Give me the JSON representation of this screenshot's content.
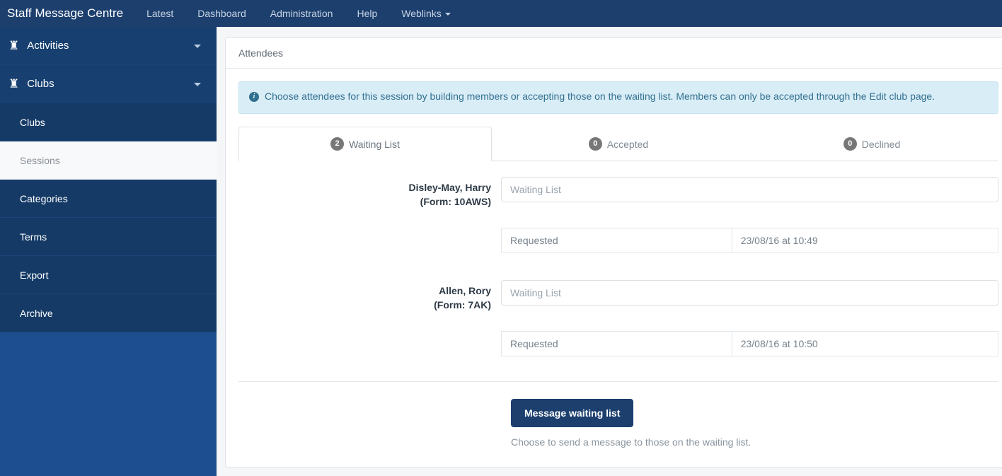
{
  "navbar": {
    "brand": "Staff Message Centre",
    "links": [
      {
        "label": "Latest"
      },
      {
        "label": "Dashboard"
      },
      {
        "label": "Administration"
      },
      {
        "label": "Help"
      },
      {
        "label": "Weblinks",
        "has_caret": true
      }
    ]
  },
  "sidebar": {
    "groups": [
      {
        "label": "Activities",
        "icon": "rook-icon"
      },
      {
        "label": "Clubs",
        "icon": "rook-icon"
      }
    ],
    "items": [
      {
        "label": "Clubs",
        "state": "sub-dark"
      },
      {
        "label": "Sessions",
        "state": "active"
      },
      {
        "label": "Categories",
        "state": "sub-dark"
      },
      {
        "label": "Terms",
        "state": "sub-dark"
      },
      {
        "label": "Export",
        "state": "sub-dark"
      },
      {
        "label": "Archive",
        "state": "sub-dark"
      }
    ]
  },
  "card": {
    "title": "Attendees",
    "alert": "Choose attendees for this session by building members or accepting those on the waiting list. Members can only be accepted through the Edit club page.",
    "alert_icon": "info-circle-icon"
  },
  "tabs": [
    {
      "count": "2",
      "label": "Waiting List",
      "active": true
    },
    {
      "count": "0",
      "label": "Accepted",
      "active": false
    },
    {
      "count": "0",
      "label": "Declined",
      "active": false
    }
  ],
  "attendees": [
    {
      "name": "Disley-May, Harry",
      "form": "(Form: 10AWS)",
      "status_placeholder": "Waiting List",
      "meta_label": "Requested",
      "meta_value": "23/08/16 at 10:49"
    },
    {
      "name": "Allen, Rory",
      "form": "(Form: 7AK)",
      "status_placeholder": "Waiting List",
      "meta_label": "Requested",
      "meta_value": "23/08/16 at 10:50"
    }
  ],
  "footer": {
    "button_label": "Message waiting list",
    "help_text": "Choose to send a message to those on the waiting list."
  },
  "colors": {
    "navbar": "#1c3f6e",
    "sidebar": "#1d4e8f",
    "sidebar_nav": "#173f6f",
    "alert_bg": "#d9edf7",
    "alert_text": "#31708f",
    "badge": "#777777",
    "primary_button": "#1c3f6e"
  }
}
